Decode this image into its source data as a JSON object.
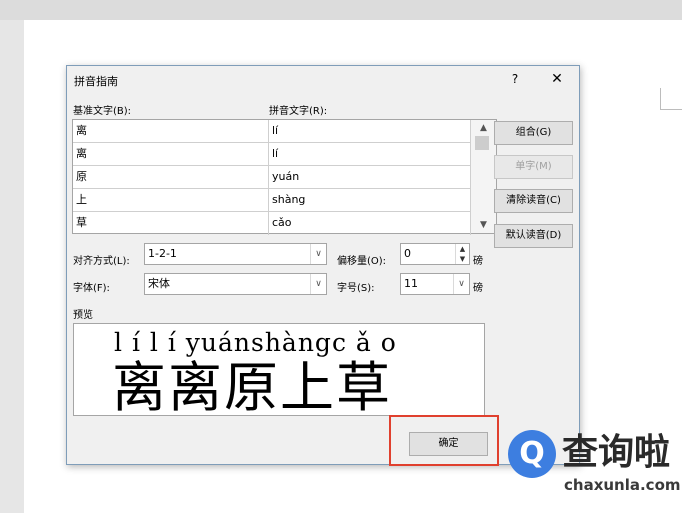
{
  "dialog": {
    "title": "拼音指南",
    "help": "?",
    "close": "✕"
  },
  "labels": {
    "base_text": "基准文字(B):",
    "ruby_text": "拼音文字(R):",
    "alignment": "对齐方式(L):",
    "offset": "偏移量(O):",
    "font": "字体(F):",
    "size": "字号(S):",
    "unit": "磅",
    "preview": "预览"
  },
  "rows": [
    {
      "base": "离",
      "ruby": "lí"
    },
    {
      "base": "离",
      "ruby": "lí"
    },
    {
      "base": "原",
      "ruby": "yuán"
    },
    {
      "base": "上",
      "ruby": "shàng"
    },
    {
      "base": "草",
      "ruby": "cǎo"
    }
  ],
  "buttons": {
    "group": "组合(G)",
    "mono": "单字(M)",
    "clear": "清除读音(C)",
    "default": "默认读音(D)",
    "ok": "确定"
  },
  "fields": {
    "alignment": "1-2-1",
    "offset": "0",
    "font": "宋体",
    "size": "11"
  },
  "preview": {
    "ruby_line": "l í l í yuánshàngc ǎ o",
    "base_line": "离离原上草"
  },
  "watermark": {
    "name": "查询啦",
    "url": "chaxunla.com"
  },
  "colors": {
    "highlight_border": "#e0402e",
    "logo": "#3d7ee0"
  }
}
